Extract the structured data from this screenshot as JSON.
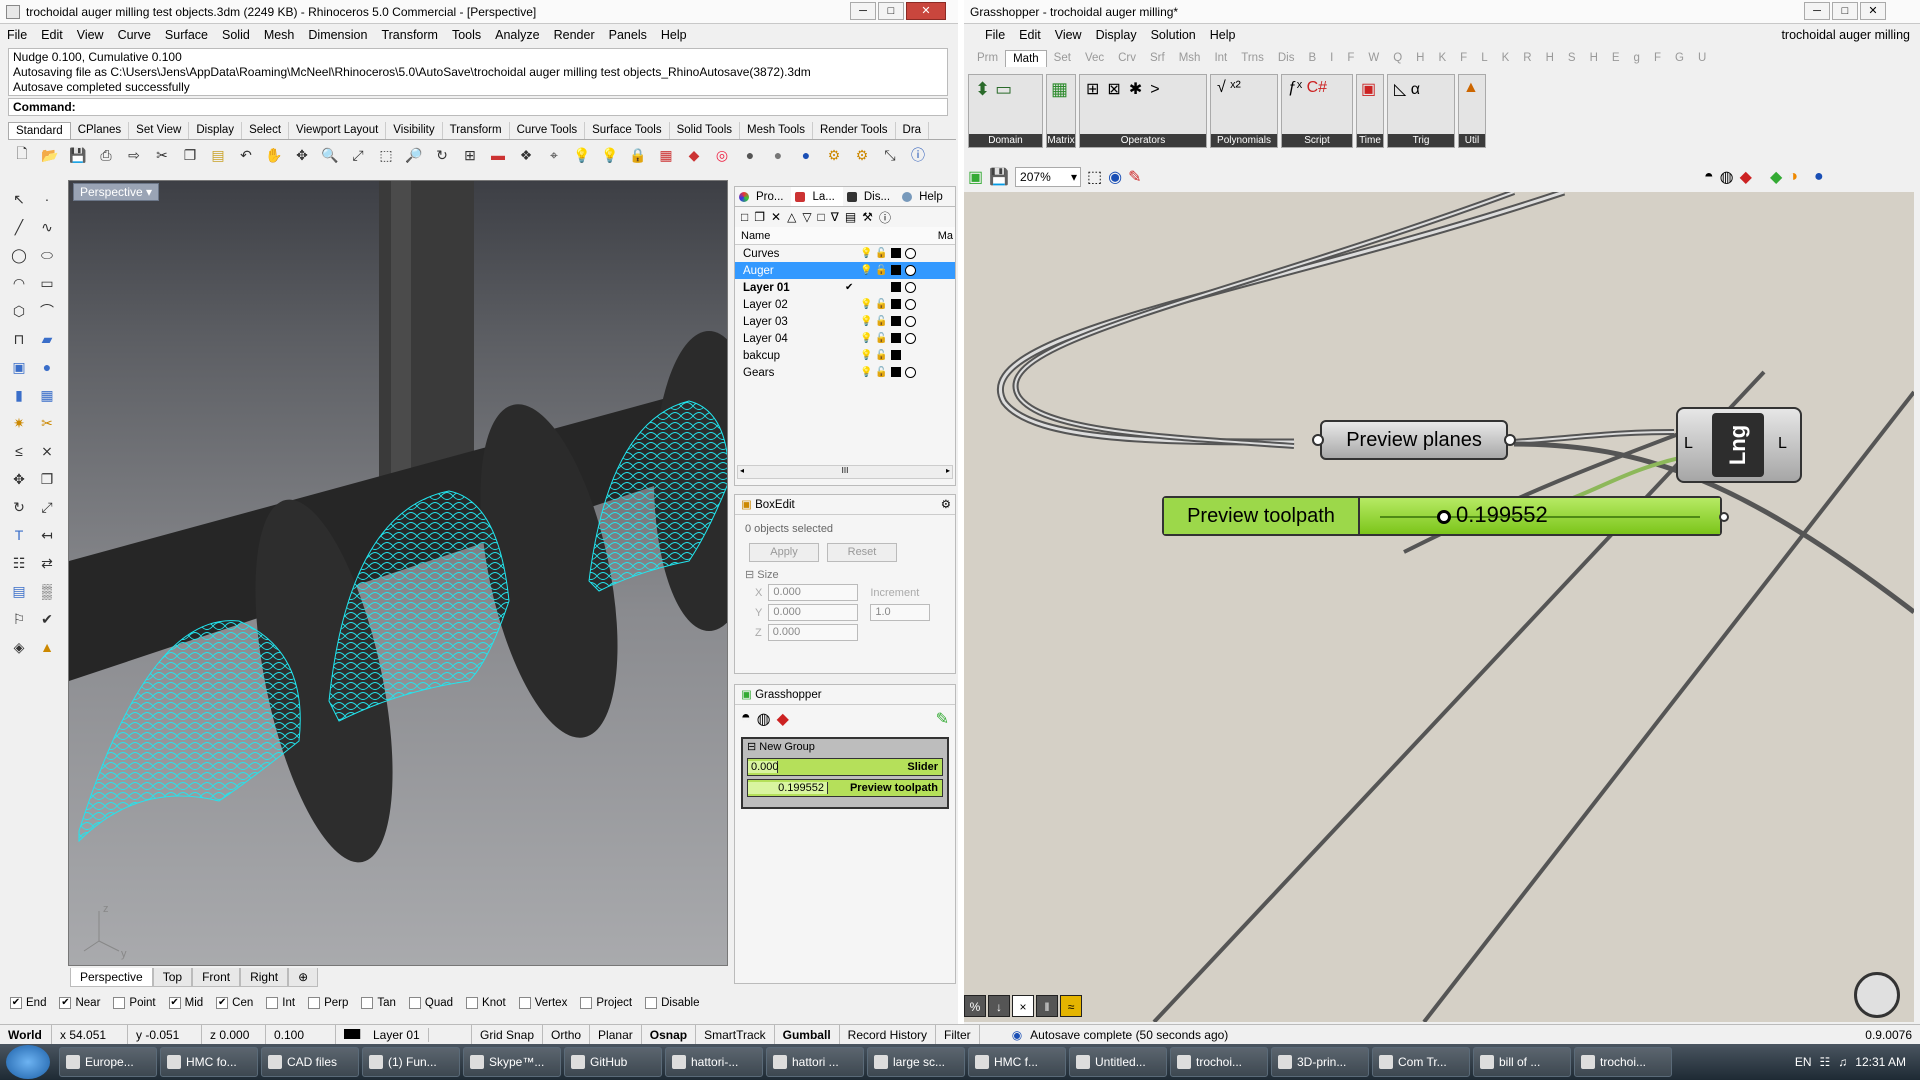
{
  "rhino": {
    "title": "trochoidal auger milling test objects.3dm (2249 KB) - Rhinoceros 5.0 Commercial - [Perspective]",
    "menu": [
      "File",
      "Edit",
      "View",
      "Curve",
      "Surface",
      "Solid",
      "Mesh",
      "Dimension",
      "Transform",
      "Tools",
      "Analyze",
      "Render",
      "Panels",
      "Help"
    ],
    "history": [
      "Nudge 0.100, Cumulative 0.100",
      "Autosaving file as C:\\Users\\Jens\\AppData\\Roaming\\McNeel\\Rhinoceros\\5.0\\AutoSave\\trochoidal auger milling test objects_RhinoAutosave(3872).3dm",
      "Autosave completed successfully"
    ],
    "command_label": "Command:",
    "tabs": [
      "Standard",
      "CPlanes",
      "Set View",
      "Display",
      "Select",
      "Viewport Layout",
      "Visibility",
      "Transform",
      "Curve Tools",
      "Surface Tools",
      "Solid Tools",
      "Mesh Tools",
      "Render Tools",
      "Dra"
    ],
    "viewport_label": "Perspective",
    "viewport_tabs": [
      "Perspective",
      "Top",
      "Front",
      "Right"
    ],
    "axis_labels": {
      "z": "z",
      "y": "y"
    },
    "layers_panel": {
      "tabs": [
        "Pro...",
        "La...",
        "Dis...",
        "Help"
      ],
      "header_name": "Name",
      "header_mat": "Ma",
      "layers": [
        {
          "name": "Curves",
          "bulb": "blue",
          "selected": false,
          "current": false
        },
        {
          "name": "Auger",
          "bulb": "blue",
          "selected": true,
          "current": false
        },
        {
          "name": "Layer 01",
          "bulb": "",
          "selected": false,
          "current": true
        },
        {
          "name": "Layer 02",
          "bulb": "yellow",
          "selected": false,
          "current": false
        },
        {
          "name": "Layer 03",
          "bulb": "yellow",
          "selected": false,
          "current": false
        },
        {
          "name": "Layer 04",
          "bulb": "yellow",
          "selected": false,
          "current": false
        },
        {
          "name": "bakcup",
          "bulb": "blue",
          "selected": false,
          "current": false
        },
        {
          "name": "Gears",
          "bulb": "yellow",
          "selected": false,
          "current": false
        }
      ],
      "scroll_mark": "III"
    },
    "boxedit": {
      "title": "BoxEdit",
      "selected": "0 objects selected",
      "apply": "Apply",
      "reset": "Reset",
      "size": "Size",
      "x_label": "X",
      "y_label": "Y",
      "z_label": "Z",
      "x": "0.000",
      "y": "0.000",
      "z": "0.000",
      "increment_label": "Increment",
      "increment": "1.0"
    },
    "ghpanel": {
      "title": "Grasshopper",
      "group": "New Group",
      "slider_value": "0.000",
      "slider_name": "Slider",
      "toolpath_value": "0.199552",
      "toolpath_name": "Preview toolpath"
    },
    "osnaps": [
      {
        "label": "End",
        "checked": true
      },
      {
        "label": "Near",
        "checked": true
      },
      {
        "label": "Point",
        "checked": false
      },
      {
        "label": "Mid",
        "checked": true
      },
      {
        "label": "Cen",
        "checked": true
      },
      {
        "label": "Int",
        "checked": false
      },
      {
        "label": "Perp",
        "checked": false
      },
      {
        "label": "Tan",
        "checked": false
      },
      {
        "label": "Quad",
        "checked": false
      },
      {
        "label": "Knot",
        "checked": false
      },
      {
        "label": "Vertex",
        "checked": false
      },
      {
        "label": "Project",
        "checked": false
      },
      {
        "label": "Disable",
        "checked": false
      }
    ],
    "status": {
      "cplane": "World",
      "x": "x 54.051",
      "y": "y -0.051",
      "z": "z 0.000",
      "units": "0.100 mm",
      "layer": "Layer 01",
      "items": [
        "Grid Snap",
        "Ortho",
        "Planar",
        "Osnap",
        "SmartTrack",
        "Gumball",
        "Record History",
        "Filter"
      ]
    }
  },
  "grasshopper": {
    "title": "Grasshopper - trochoidal auger milling*",
    "doc_name": "trochoidal auger milling",
    "menu": [
      "File",
      "Edit",
      "View",
      "Display",
      "Solution",
      "Help"
    ],
    "tabs": [
      "Prm",
      "Math",
      "Set",
      "Vec",
      "Crv",
      "Srf",
      "Msh",
      "Int",
      "Trns",
      "Dis",
      "B",
      "I",
      "F",
      "W",
      "Q",
      "H",
      "K",
      "F",
      "L",
      "K",
      "R",
      "H",
      "S",
      "H",
      "E",
      "g",
      "F",
      "G",
      "U"
    ],
    "groups": [
      "Domain",
      "Matrix",
      "Operators",
      "Polynomials",
      "Script",
      "Time",
      "Trig",
      "Util"
    ],
    "zoom": "207%",
    "preview_planes": "Preview planes",
    "len_label": "Lng",
    "len_in": "L",
    "len_out": "L",
    "slider_label": "Preview toolpath",
    "slider_value": "0.199552",
    "slider_fraction": 0.2,
    "status": "Autosave complete (50 seconds ago)",
    "version": "0.9.0076",
    "bottom_icons": [
      "%",
      "↓",
      "×",
      "‖",
      "≈"
    ]
  },
  "taskbar": {
    "tasks": [
      "Europe...",
      "HMC fo...",
      "CAD files",
      "(1) Fun...",
      "Skype™...",
      "GitHub",
      "hattori-...",
      "hattori ...",
      "large sc...",
      "HMC f...",
      "Untitled...",
      "trochoi...",
      "3D-prin...",
      "Com Tr...",
      "bill of ...",
      "trochoi..."
    ],
    "lang": "EN",
    "time": "12:31 AM"
  }
}
